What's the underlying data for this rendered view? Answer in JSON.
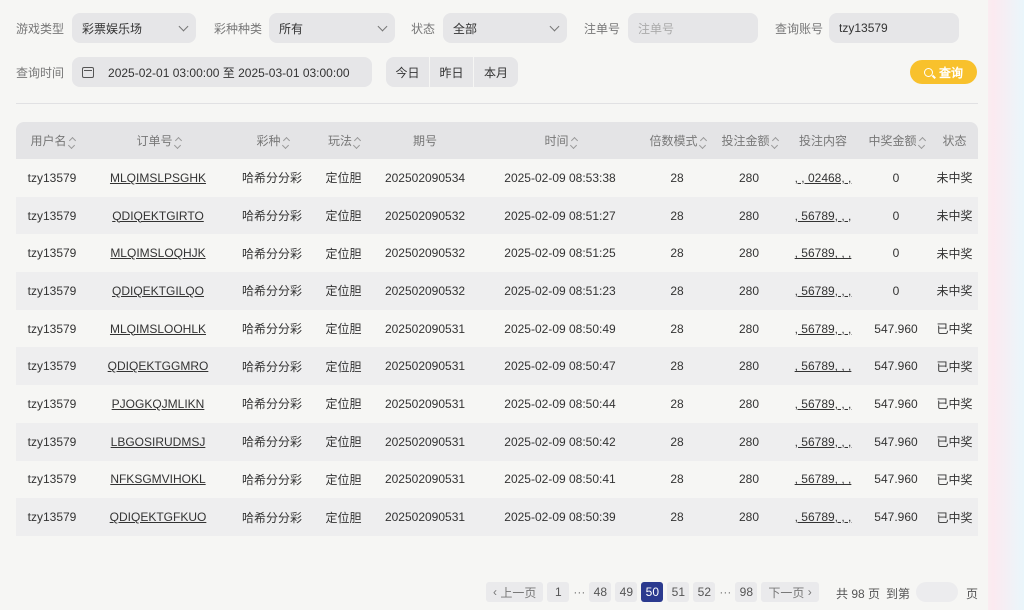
{
  "filters": {
    "game_type": {
      "label": "游戏类型",
      "value": "彩票娱乐场"
    },
    "lottery_type": {
      "label": "彩种种类",
      "value": "所有"
    },
    "status": {
      "label": "状态",
      "value": "全部"
    },
    "order_no": {
      "label": "注单号",
      "placeholder": "注单号"
    },
    "account": {
      "label": "查询账号",
      "value": "tzy13579"
    },
    "time": {
      "label": "查询时间",
      "value": "2025-02-01 03:00:00 至 2025-03-01 03:00:00"
    },
    "quick": [
      "今日",
      "昨日",
      "本月"
    ],
    "search_label": "查询"
  },
  "table": {
    "headers": [
      "用户名",
      "订单号",
      "彩种",
      "玩法",
      "期号",
      "时间",
      "倍数模式",
      "投注金额",
      "投注内容",
      "中奖金额",
      "状态"
    ],
    "rows": [
      [
        "tzy13579",
        "MLQIMSLPSGHK",
        "哈希分分彩",
        "定位胆",
        "202502090534",
        "2025-02-09 08:53:38",
        "28",
        "280",
        ", , 02468, ,",
        "0",
        "未中奖"
      ],
      [
        "tzy13579",
        "QDIQEKTGIRTO",
        "哈希分分彩",
        "定位胆",
        "202502090532",
        "2025-02-09 08:51:27",
        "28",
        "280",
        ", 56789, , ,",
        "0",
        "未中奖"
      ],
      [
        "tzy13579",
        "MLQIMSLOQHJK",
        "哈希分分彩",
        "定位胆",
        "202502090532",
        "2025-02-09 08:51:25",
        "28",
        "280",
        ", 56789, , ,",
        "0",
        "未中奖"
      ],
      [
        "tzy13579",
        "QDIQEKTGILQO",
        "哈希分分彩",
        "定位胆",
        "202502090532",
        "2025-02-09 08:51:23",
        "28",
        "280",
        ", 56789, , ,",
        "0",
        "未中奖"
      ],
      [
        "tzy13579",
        "MLQIMSLOOHLK",
        "哈希分分彩",
        "定位胆",
        "202502090531",
        "2025-02-09 08:50:49",
        "28",
        "280",
        ", 56789, , ,",
        "547.960",
        "已中奖"
      ],
      [
        "tzy13579",
        "QDIQEKTGGMRO",
        "哈希分分彩",
        "定位胆",
        "202502090531",
        "2025-02-09 08:50:47",
        "28",
        "280",
        ", 56789, , ,",
        "547.960",
        "已中奖"
      ],
      [
        "tzy13579",
        "PJOGKQJMLIKN",
        "哈希分分彩",
        "定位胆",
        "202502090531",
        "2025-02-09 08:50:44",
        "28",
        "280",
        ", 56789, , ,",
        "547.960",
        "已中奖"
      ],
      [
        "tzy13579",
        "LBGOSIRUDMSJ",
        "哈希分分彩",
        "定位胆",
        "202502090531",
        "2025-02-09 08:50:42",
        "28",
        "280",
        ", 56789, , ,",
        "547.960",
        "已中奖"
      ],
      [
        "tzy13579",
        "NFKSGMVIHOKL",
        "哈希分分彩",
        "定位胆",
        "202502090531",
        "2025-02-09 08:50:41",
        "28",
        "280",
        ", 56789, , ,",
        "547.960",
        "已中奖"
      ],
      [
        "tzy13579",
        "QDIQEKTGFKUO",
        "哈希分分彩",
        "定位胆",
        "202502090531",
        "2025-02-09 08:50:39",
        "28",
        "280",
        ", 56789, , ,",
        "547.960",
        "已中奖"
      ]
    ]
  },
  "pagination": {
    "prev": "上一页",
    "next": "下一页",
    "first": "1",
    "pages": [
      "48",
      "49",
      "50",
      "51",
      "52"
    ],
    "current": "50",
    "last": "98",
    "ellipsis": "···",
    "total": "共 98 页",
    "goto": "到第",
    "unit": "页"
  },
  "colors": {
    "accent": "#f8c12c",
    "active_page": "#2b3a8f"
  }
}
